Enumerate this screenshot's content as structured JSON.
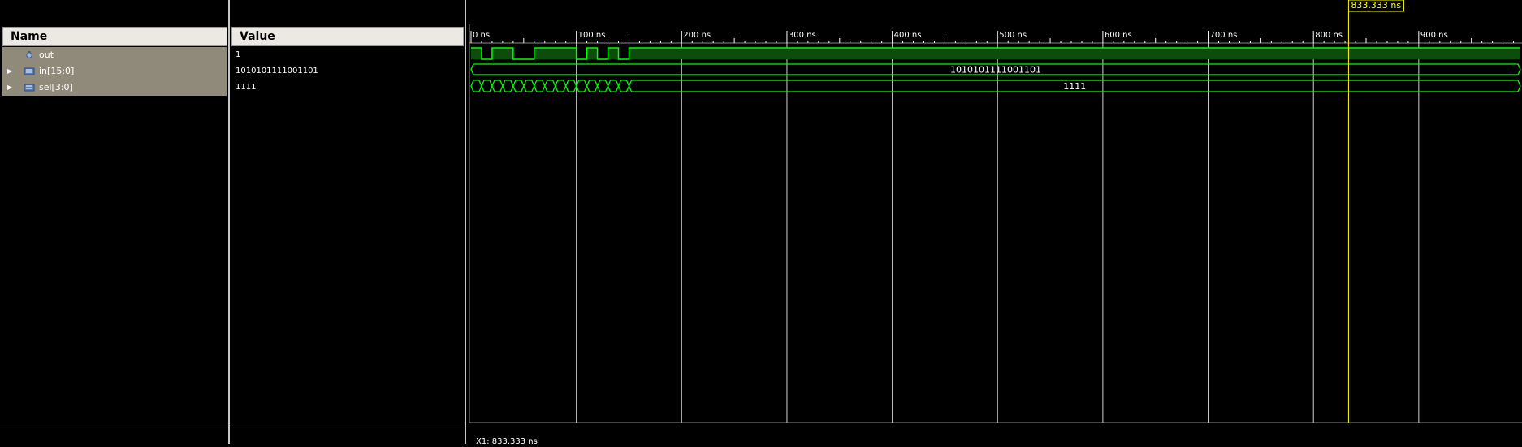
{
  "columns": {
    "name": "Name",
    "value": "Value"
  },
  "signals": [
    {
      "name": "out",
      "value": "1",
      "expandable": false,
      "icon": "scalar-signal-icon"
    },
    {
      "name": "in[15:0]",
      "value": "1010101111001101",
      "expandable": true,
      "icon": "bus-signal-icon"
    },
    {
      "name": "sel[3:0]",
      "value": "1111",
      "expandable": true,
      "icon": "bus-signal-icon"
    }
  ],
  "timeline": {
    "unit": "ns",
    "ticks": [
      "0 ns",
      "100 ns",
      "200 ns",
      "300 ns",
      "400 ns",
      "500 ns",
      "600 ns",
      "700 ns",
      "800 ns",
      "900 ns"
    ],
    "visible_range_ns": [
      0,
      1000
    ]
  },
  "waves": {
    "out_transitions_ns": [
      0,
      10,
      20,
      40,
      60,
      100,
      110,
      120,
      130,
      140,
      150
    ],
    "out_levels": [
      1,
      0,
      1,
      0,
      1,
      0,
      1,
      0,
      1,
      0,
      1
    ],
    "in_label": "1010101111001101",
    "sel_transitions_ns": [
      0,
      10,
      20,
      30,
      40,
      50,
      60,
      70,
      80,
      90,
      100,
      110,
      120,
      130,
      140,
      150
    ],
    "sel_label": "1111"
  },
  "cursor": {
    "time_ns": 833.333,
    "label": "833.333 ns",
    "status": "X1: 833.333 ns"
  },
  "colors": {
    "wave": "#00ff00",
    "cursor": "#ffff00",
    "grid": "#ffffff",
    "background": "#000000",
    "selected_row": "#908a7a"
  }
}
